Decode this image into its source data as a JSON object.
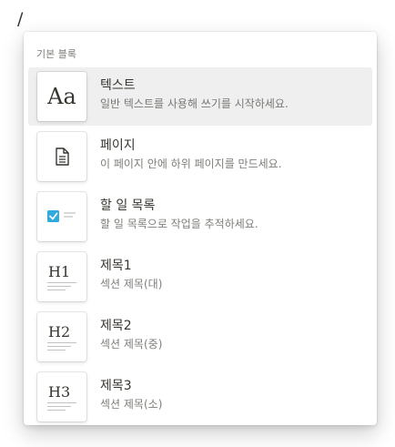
{
  "editor": {
    "slash_text": "/"
  },
  "menu": {
    "section_title": "기본 블록",
    "items": [
      {
        "icon": "text-aa-icon",
        "thumb_text": "Aa",
        "title": "텍스트",
        "description": "일반 텍스트를 사용해 쓰기를 시작하세요.",
        "selected": true
      },
      {
        "icon": "page-document-icon",
        "title": "페이지",
        "description": "이 페이지 안에 하위 페이지를 만드세요."
      },
      {
        "icon": "todo-checkbox-icon",
        "title": "할 일 목록",
        "description": "할 일 목록으로 작업을 추적하세요."
      },
      {
        "icon": "heading1-icon",
        "thumb_text": "H1",
        "title": "제목1",
        "description": "섹션 제목(대)"
      },
      {
        "icon": "heading2-icon",
        "thumb_text": "H2",
        "title": "제목2",
        "description": "섹션 제목(중)"
      },
      {
        "icon": "heading3-icon",
        "thumb_text": "H3",
        "title": "제목3",
        "description": "섹션 제목(소)"
      }
    ]
  },
  "colors": {
    "text": "#37352f",
    "selected_bg": "rgba(55,53,47,0.08)",
    "checkbox": "#2eaadc"
  }
}
